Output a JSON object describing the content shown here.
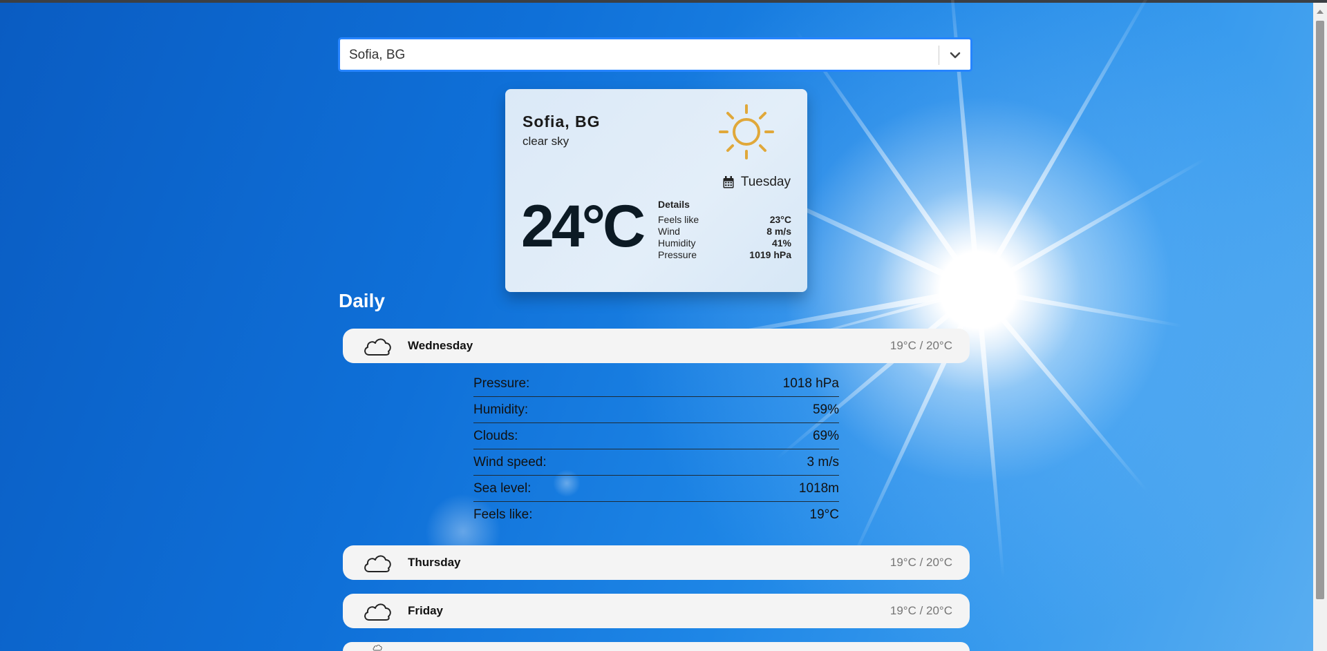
{
  "search": {
    "value": "Sofia, BG"
  },
  "current": {
    "city": "Sofia, BG",
    "description": "clear sky",
    "day": "Tuesday",
    "temperature": "24°C",
    "details_title": "Details",
    "details": [
      {
        "label": "Feels like",
        "value": "23°C"
      },
      {
        "label": "Wind",
        "value": "8 m/s"
      },
      {
        "label": "Humidity",
        "value": "41%"
      },
      {
        "label": "Pressure",
        "value": "1019 hPa"
      }
    ]
  },
  "daily": {
    "heading": "Daily",
    "days": [
      {
        "name": "Wednesday",
        "range": "19°C / 20°C",
        "icon": "cloud-icon"
      },
      {
        "name": "Thursday",
        "range": "19°C / 20°C",
        "icon": "cloud-icon"
      },
      {
        "name": "Friday",
        "range": "19°C / 20°C",
        "icon": "cloud-icon"
      }
    ],
    "expanded": [
      {
        "label": "Pressure:",
        "value": "1018 hPa"
      },
      {
        "label": "Humidity:",
        "value": "59%"
      },
      {
        "label": "Clouds:",
        "value": "69%"
      },
      {
        "label": "Wind speed:",
        "value": "3 m/s"
      },
      {
        "label": "Sea level:",
        "value": "1018m"
      },
      {
        "label": "Feels like:",
        "value": "19°C"
      }
    ]
  },
  "colors": {
    "sun_icon": "#e0a83a",
    "select_focus": "#2684ff",
    "sky": "#1278de"
  }
}
